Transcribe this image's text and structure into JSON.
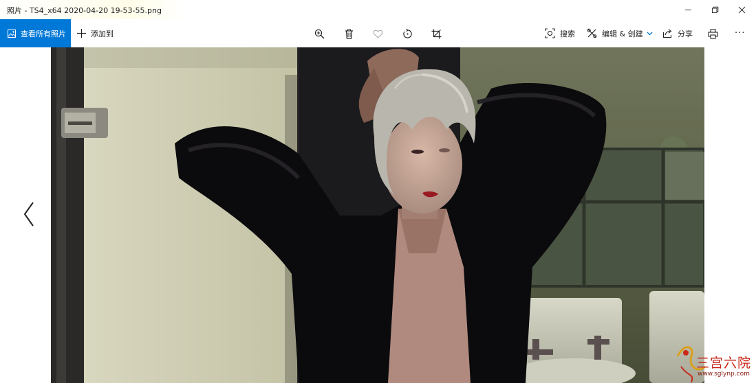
{
  "window": {
    "title": "照片 - TS4_x64 2020-04-20 19-53-55.png",
    "controls": [
      "minimize-icon",
      "restore-icon",
      "close-icon"
    ]
  },
  "toolbar": {
    "view_all_label": "查看所有照片",
    "add_to_label": "添加到",
    "icons_center": [
      "zoom-icon",
      "delete-icon",
      "favorite-heart-icon",
      "rotate-icon",
      "crop-icon"
    ],
    "search_label": "搜索",
    "edit_create_label": "编辑 & 创建",
    "share_label": "分享",
    "more_label": "···",
    "accent_color": "#0078d7"
  },
  "viewer": {
    "prev_icon": "chevron-left-icon"
  },
  "watermark": {
    "text": "三宫六院",
    "url": "www.sglynp.com"
  }
}
